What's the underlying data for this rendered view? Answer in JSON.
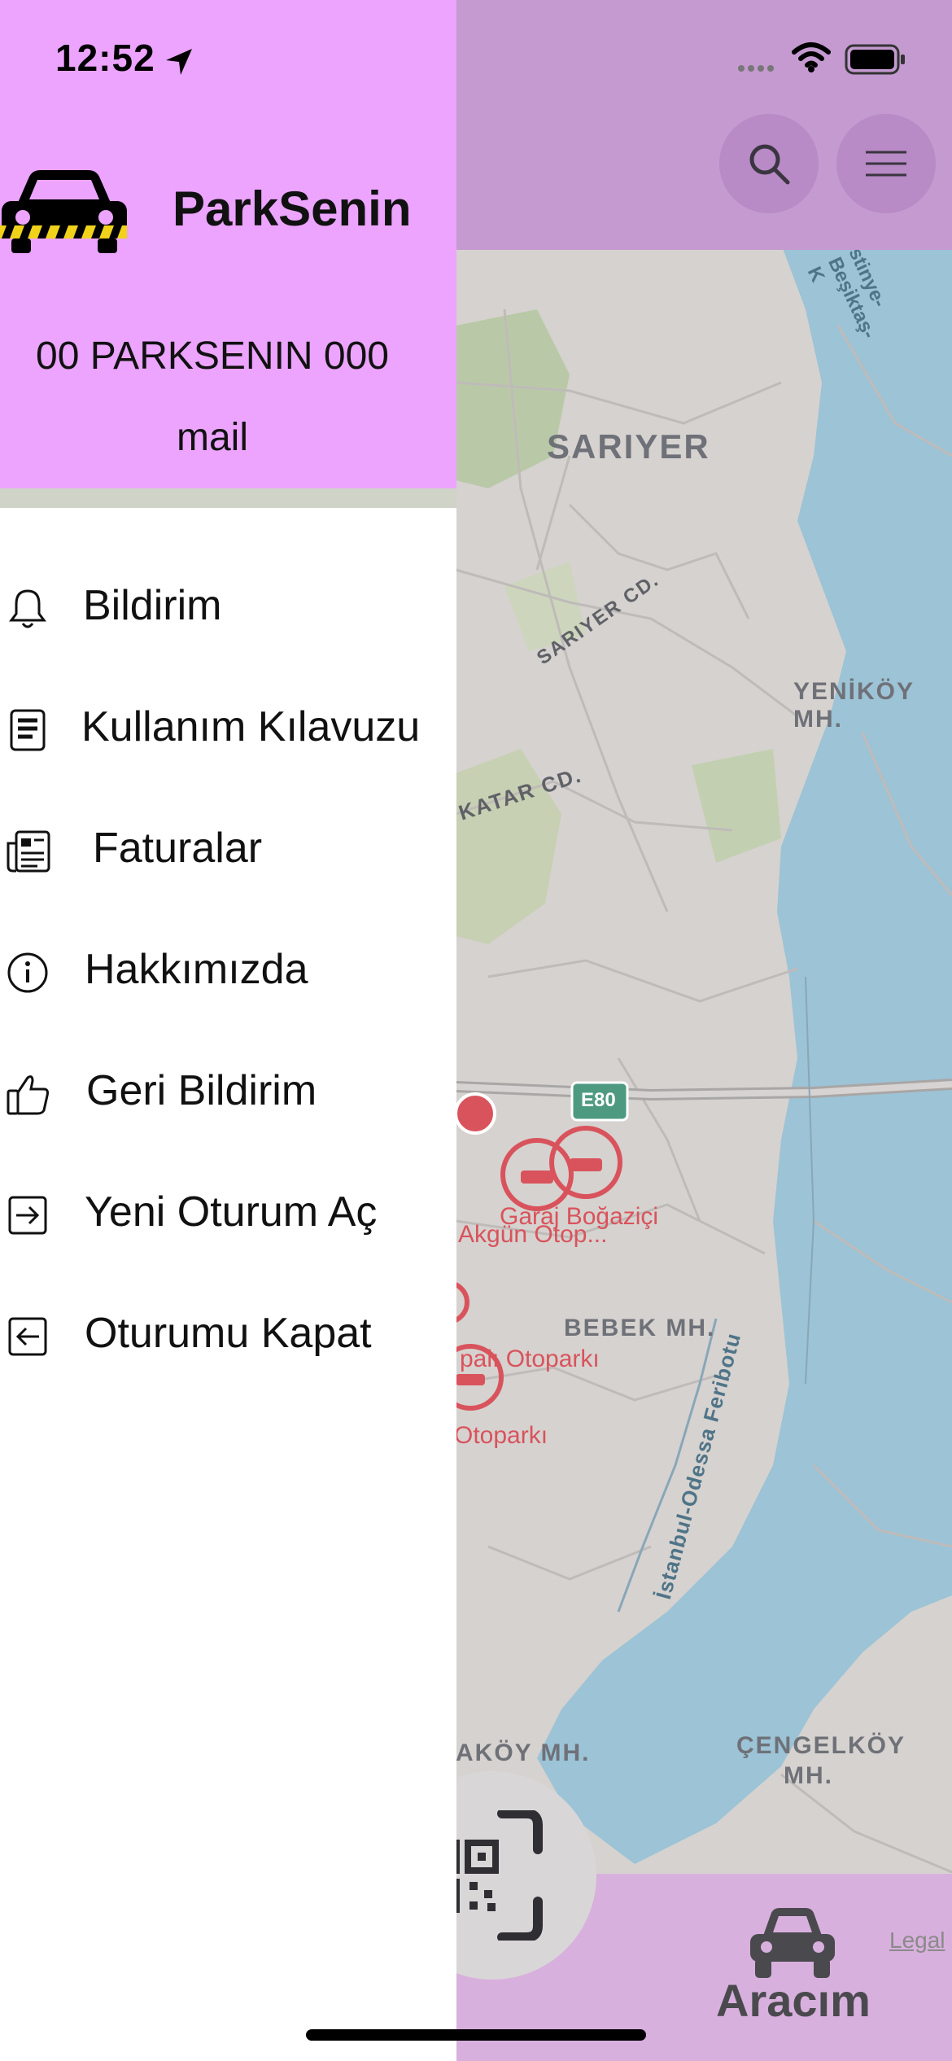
{
  "status_bar": {
    "time": "12:52"
  },
  "drawer": {
    "app_name": "ParkSenin",
    "user_name": "00 PARKSENIN 000",
    "user_email": "mail",
    "menu": [
      {
        "label": "Bildirim",
        "icon": "bell-icon"
      },
      {
        "label": "Kullanım Kılavuzu",
        "icon": "document-icon"
      },
      {
        "label": "Faturalar",
        "icon": "invoice-icon"
      },
      {
        "label": "Hakkımızda",
        "icon": "info-icon"
      },
      {
        "label": "Geri Bildirim",
        "icon": "thumbs-up-icon"
      },
      {
        "label": "Yeni Oturum Aç",
        "icon": "login-icon"
      },
      {
        "label": "Oturumu Kapat",
        "icon": "logout-icon"
      }
    ]
  },
  "map": {
    "labels": {
      "sariyer": "SARIYER",
      "sariyer_cd": "SARIYER CD.",
      "katar_cd": "KATAR CD.",
      "yenikoy": "YENİKÖY MH.",
      "e80": "E80",
      "garaj": "Garaj Boğaziçi",
      "akgun": "Akgün Otop...",
      "bebek": "BEBEK MH.",
      "kapali": "palı Otoparkı",
      "otoparki": "Otoparkı",
      "feribot": "İstanbul-Odessa Feribotu",
      "koy": "AKÖY MH.",
      "cengelkoy_1": "ÇENGELKÖY",
      "cengelkoy_2": "MH.",
      "road_top": "stinye-Beşiktaş-K",
      "legal": "Legal"
    }
  },
  "tab_bar": {
    "vehicle_label": "Aracım"
  },
  "colors": {
    "drawer_header": "#eca4fe",
    "top_band": "#c49ad0",
    "water": "#9cc3d6",
    "parking_red": "#d9535c"
  }
}
